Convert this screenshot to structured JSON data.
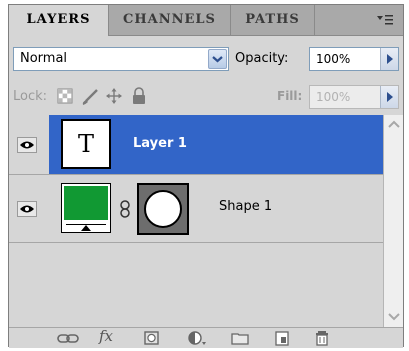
{
  "tabs": [
    {
      "label": "LAYERS",
      "active": true
    },
    {
      "label": "CHANNELS",
      "active": false
    },
    {
      "label": "PATHS",
      "active": false
    }
  ],
  "panel_menu_icon": "panel-menu-icon",
  "blend_mode": "Normal",
  "opacity": {
    "label": "Opacity:",
    "value": "100%"
  },
  "lock": {
    "label": "Lock:",
    "icons": [
      "lock-transparent-icon",
      "lock-image-icon",
      "lock-position-icon",
      "lock-all-icon"
    ]
  },
  "fill": {
    "label": "Fill:",
    "value": "100%"
  },
  "layers": [
    {
      "name": "Layer 1",
      "type": "text",
      "thumb_glyph": "T",
      "selected": true,
      "visible": true
    },
    {
      "name": "Shape 1",
      "type": "shape",
      "fill_color": "#119933",
      "selected": false,
      "visible": true
    }
  ],
  "footer_icons": [
    "link-layers-icon",
    "fx-icon",
    "add-mask-icon",
    "adjustment-layer-icon",
    "new-group-icon",
    "new-layer-icon",
    "delete-layer-icon"
  ],
  "footer_fx_glyph": "fx",
  "colors": {
    "selection": "#3265c8",
    "shape_fill": "#119933",
    "panel": "#d6d6d6"
  }
}
